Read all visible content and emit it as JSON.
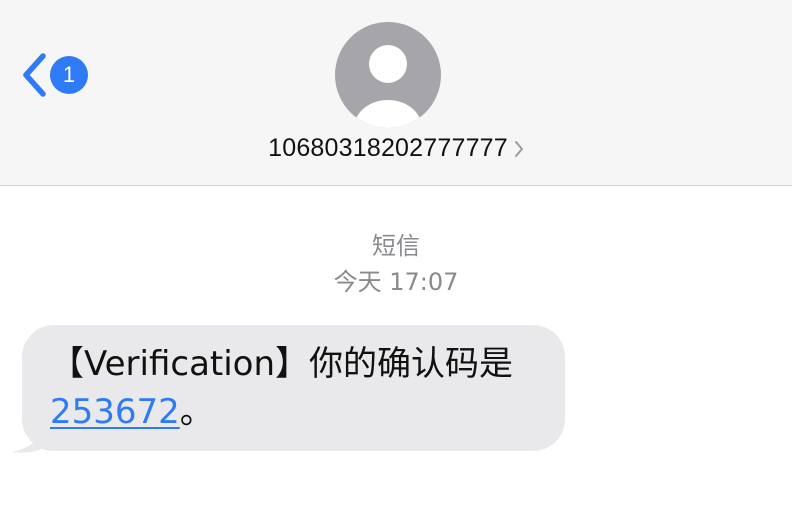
{
  "header": {
    "back_badge_count": "1",
    "contact_name": "10680318202777777"
  },
  "conversation": {
    "service_label": "短信",
    "timestamp": "今天 17:07"
  },
  "message": {
    "text_before_code": "【Verification】你的确认码是 ",
    "code": "253672",
    "text_after_code": "。"
  },
  "colors": {
    "accent": "#2f7bf5",
    "bubble_bg": "#e9e9eb",
    "header_bg": "#f6f6f6",
    "meta_text": "#8a8a8e"
  },
  "icons": {
    "back": "chevron-left-icon",
    "avatar": "person-silhouette-icon",
    "contact_details": "chevron-right-icon"
  }
}
